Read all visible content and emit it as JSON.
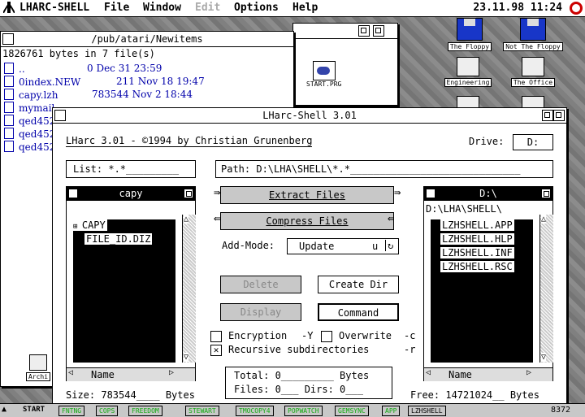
{
  "menubar": {
    "items": [
      "LHARC-SHELL",
      "File",
      "Window",
      "Edit",
      "Options",
      "Help"
    ],
    "disabled": [
      "Edit"
    ],
    "clock": "23.11.98 11:24"
  },
  "filewin": {
    "title": "/pub/atari/Newitems",
    "info": "1826761 bytes in 7 file(s)",
    "rows": [
      {
        "name": "..",
        "detail": "0 Dec 31 23:59"
      },
      {
        "name": "0index.NEW",
        "detail": "211 Nov 18 19:47"
      },
      {
        "name": "capy.lzh",
        "detail": "783544 Nov 2 18:44"
      },
      {
        "name": "mymail.",
        "detail": ""
      },
      {
        "name": "qed452",
        "detail": ""
      },
      {
        "name": "qed452",
        "detail": ""
      },
      {
        "name": "qed452",
        "detail": ""
      }
    ]
  },
  "desktop": {
    "start_prg": "START.PRG",
    "icons": [
      "The Floppy",
      "Not The Floppy",
      "Engineering",
      "The Office",
      "Archi"
    ]
  },
  "dialog": {
    "title": "LHarc-Shell 3.01",
    "header": "LHarc 3.01 - ©1994 by Christian Grunenberg",
    "drive_label": "Drive:",
    "drive_value": "D:",
    "list_label": "List: *.*_________",
    "path_label": "Path: D:\\LHA\\SHELL\\*.*_____________________________",
    "left_pane": {
      "title": "capy",
      "items": [
        "CAPY",
        "FILE_ID.DIZ"
      ],
      "footer": "Name"
    },
    "right_pane": {
      "title": "D:\\",
      "path": "D:\\LHA\\SHELL\\",
      "items": [
        "LZHSHELL.APP",
        "LZHSHELL.HLP",
        "LZHSHELL.INF",
        "LZHSHELL.RSC"
      ],
      "footer": "Name"
    },
    "extract": "Extract Files",
    "compress": "Compress Files",
    "addmode_label": "Add-Mode:",
    "addmode_value": "Update",
    "addmode_key": "u",
    "delete": "Delete",
    "create_dir": "Create Dir",
    "display": "Display",
    "command": "Command",
    "encryption": "Encryption",
    "encryption_key": "-Y",
    "overwrite": "Overwrite",
    "overwrite_key": "-c",
    "recursive": "Recursive subdirectories",
    "recursive_key": "-r",
    "total_label": "Total: 0_________ Bytes",
    "files_label": "Files: 0___  Dirs: 0___",
    "size_label": "Size: 783544____ Bytes",
    "free_label": "Free: 14721024__ Bytes"
  },
  "taskbar": {
    "start": "START",
    "tasks": [
      "FNTNG",
      "COPS",
      "FREEDOM",
      "STEWART",
      "TMOCOPY4",
      "POPWATCH",
      "GEMSYNC",
      "APP",
      "LZHSHELL"
    ],
    "status": "8372"
  }
}
